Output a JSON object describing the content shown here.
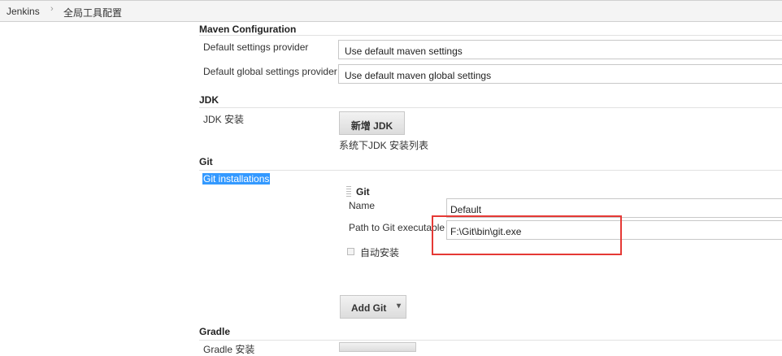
{
  "breadcrumb": {
    "items": [
      "Jenkins",
      "全局工具配置"
    ]
  },
  "maven": {
    "title": "Maven Configuration",
    "default_settings_label": "Default settings provider",
    "default_settings_value": "Use default maven settings",
    "global_settings_label": "Default global settings provider",
    "global_settings_value": "Use default maven global settings"
  },
  "jdk": {
    "title": "JDK",
    "install_label": "JDK 安装",
    "add_button": "新增 JDK",
    "hint": "系统下JDK 安装列表"
  },
  "git": {
    "title": "Git",
    "installations_label": "Git installations",
    "entry_title": "Git",
    "name_label": "Name",
    "name_value": "Default",
    "path_label": "Path to Git executable",
    "path_value": "F:\\Git\\bin\\git.exe",
    "auto_install_label": "自动安装",
    "add_button": "Add Git",
    "add_button_caret": "▾"
  },
  "gradle": {
    "title": "Gradle",
    "install_label": "Gradle 安装"
  },
  "colors": {
    "highlight": "#e53935",
    "selection": "#3399ff"
  }
}
